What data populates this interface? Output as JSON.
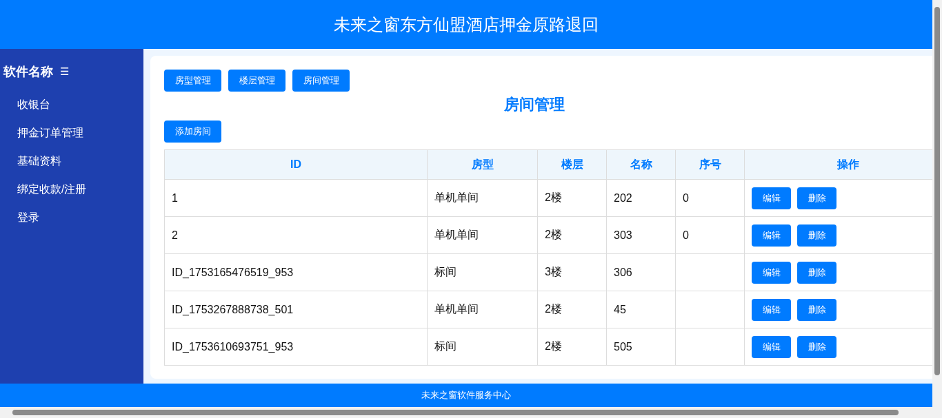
{
  "header": {
    "title": "未来之窗东方仙盟酒店押金原路退回"
  },
  "sidebar": {
    "brand": "软件名称",
    "menu_icon": "☰",
    "items": [
      {
        "label": "收银台"
      },
      {
        "label": "押金订单管理"
      },
      {
        "label": "基础资料"
      },
      {
        "label": "绑定收款/注册"
      },
      {
        "label": "登录"
      }
    ]
  },
  "tabs": [
    {
      "label": "房型管理"
    },
    {
      "label": "楼层管理"
    },
    {
      "label": "房间管理"
    }
  ],
  "page_title": "房间管理",
  "add_button": "添加房间",
  "table": {
    "columns": [
      "ID",
      "房型",
      "楼层",
      "名称",
      "序号",
      "操作"
    ],
    "rows": [
      {
        "cells": [
          "1",
          "单机单间",
          "2楼",
          "202",
          "0"
        ],
        "actions": [
          "编辑",
          "删除"
        ]
      },
      {
        "cells": [
          "2",
          "单机单间",
          "2楼",
          "303",
          "0"
        ],
        "actions": [
          "编辑",
          "删除"
        ]
      },
      {
        "cells": [
          "ID_1753165476519_953",
          "标间",
          "3楼",
          "306",
          ""
        ],
        "actions": [
          "编辑",
          "删除"
        ]
      },
      {
        "cells": [
          "ID_1753267888738_501",
          "单机单间",
          "2楼",
          "45",
          ""
        ],
        "actions": [
          "编辑",
          "删除"
        ]
      },
      {
        "cells": [
          "ID_1753610693751_953",
          "标间",
          "2楼",
          "505",
          ""
        ],
        "actions": [
          "编辑",
          "删除"
        ]
      }
    ]
  },
  "footer": {
    "text": "未来之窗软件服务中心"
  }
}
